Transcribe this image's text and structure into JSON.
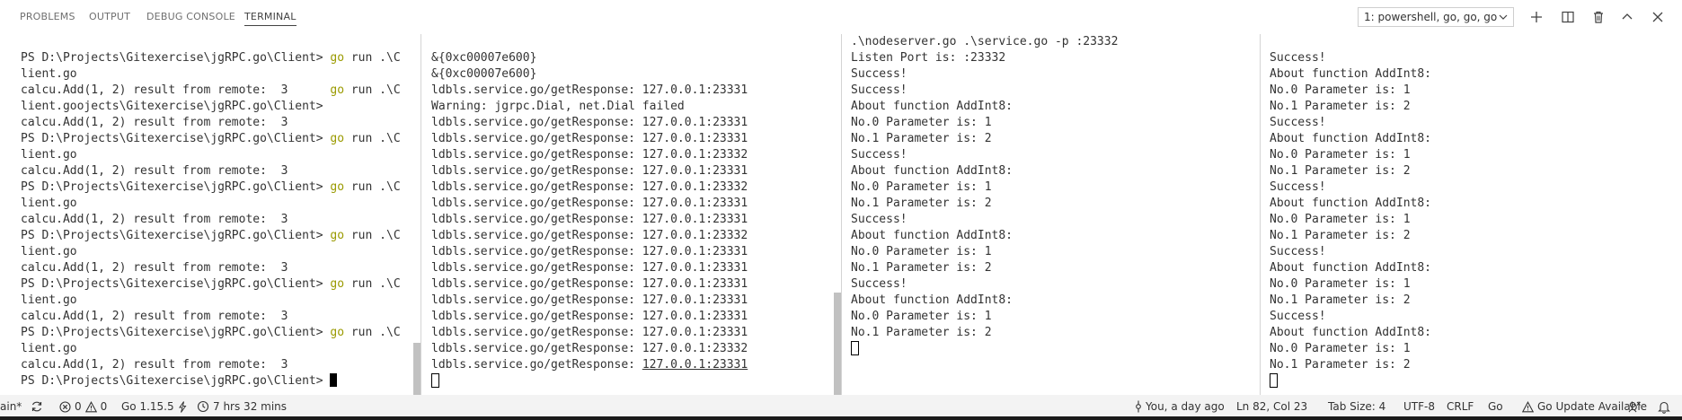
{
  "panel": {
    "tabs": [
      "PROBLEMS",
      "OUTPUT",
      "DEBUG CONSOLE",
      "TERMINAL"
    ],
    "active_tab": "TERMINAL",
    "terminal_select": "1: powershell, go, go, go"
  },
  "terminals": [
    {
      "lines": [
        {
          "text": ""
        },
        {
          "text": "PS D:\\Projects\\Gitexercise\\jgRPC.go\\Client> ",
          "cmd": "go",
          "rest": " run .\\C"
        },
        {
          "text": "lient.go"
        },
        {
          "text": "calcu.Add(1, 2) result from remote:  3      ",
          "cmd": "go",
          "rest": " run .\\C"
        },
        {
          "text": "lient.goojects\\Gitexercise\\jgRPC.go\\Client>"
        },
        {
          "text": "calcu.Add(1, 2) result from remote:  3"
        },
        {
          "text": "PS D:\\Projects\\Gitexercise\\jgRPC.go\\Client> ",
          "cmd": "go",
          "rest": " run .\\C"
        },
        {
          "text": "lient.go"
        },
        {
          "text": "calcu.Add(1, 2) result from remote:  3"
        },
        {
          "text": "PS D:\\Projects\\Gitexercise\\jgRPC.go\\Client> ",
          "cmd": "go",
          "rest": " run .\\C"
        },
        {
          "text": "lient.go"
        },
        {
          "text": "calcu.Add(1, 2) result from remote:  3"
        },
        {
          "text": "PS D:\\Projects\\Gitexercise\\jgRPC.go\\Client> ",
          "cmd": "go",
          "rest": " run .\\C"
        },
        {
          "text": "lient.go"
        },
        {
          "text": "calcu.Add(1, 2) result from remote:  3"
        },
        {
          "text": "PS D:\\Projects\\Gitexercise\\jgRPC.go\\Client> ",
          "cmd": "go",
          "rest": " run .\\C"
        },
        {
          "text": "lient.go"
        },
        {
          "text": "calcu.Add(1, 2) result from remote:  3"
        },
        {
          "text": "PS D:\\Projects\\Gitexercise\\jgRPC.go\\Client> ",
          "cmd": "go",
          "rest": " run .\\C"
        },
        {
          "text": "lient.go"
        },
        {
          "text": "calcu.Add(1, 2) result from remote:  3"
        },
        {
          "text": "PS D:\\Projects\\Gitexercise\\jgRPC.go\\Client> ",
          "cursor": "filled"
        }
      ]
    },
    {
      "lines": [
        {
          "text": ""
        },
        {
          "text": "&{0xc00007e600}"
        },
        {
          "text": "&{0xc00007e600}"
        },
        {
          "text": "ldbls.service.go/getResponse: 127.0.0.1:23331"
        },
        {
          "text": "Warning: jgrpc.Dial, net.Dial failed"
        },
        {
          "text": "ldbls.service.go/getResponse: 127.0.0.1:23331"
        },
        {
          "text": "ldbls.service.go/getResponse: 127.0.0.1:23331"
        },
        {
          "text": "ldbls.service.go/getResponse: 127.0.0.1:23332"
        },
        {
          "text": "ldbls.service.go/getResponse: 127.0.0.1:23331"
        },
        {
          "text": "ldbls.service.go/getResponse: 127.0.0.1:23332"
        },
        {
          "text": "ldbls.service.go/getResponse: 127.0.0.1:23331"
        },
        {
          "text": "ldbls.service.go/getResponse: 127.0.0.1:23331"
        },
        {
          "text": "ldbls.service.go/getResponse: 127.0.0.1:23332"
        },
        {
          "text": "ldbls.service.go/getResponse: 127.0.0.1:23331"
        },
        {
          "text": "ldbls.service.go/getResponse: 127.0.0.1:23331"
        },
        {
          "text": "ldbls.service.go/getResponse: 127.0.0.1:23331"
        },
        {
          "text": "ldbls.service.go/getResponse: 127.0.0.1:23331"
        },
        {
          "text": "ldbls.service.go/getResponse: 127.0.0.1:23331"
        },
        {
          "text": "ldbls.service.go/getResponse: 127.0.0.1:23331"
        },
        {
          "text": "ldbls.service.go/getResponse: 127.0.0.1:23332"
        },
        {
          "text": "ldbls.service.go/getResponse: ",
          "link": "127.0.0.1:23331"
        },
        {
          "text": "",
          "cursor": "hollow"
        }
      ]
    },
    {
      "lines": [
        {
          "text": ".\\nodeserver.go .\\service.go -p :23332"
        },
        {
          "text": "Listen Port is: :23332"
        },
        {
          "text": "Success!"
        },
        {
          "text": "Success!"
        },
        {
          "text": "About function AddInt8:"
        },
        {
          "text": "No.0 Parameter is: 1"
        },
        {
          "text": "No.1 Parameter is: 2"
        },
        {
          "text": "Success!"
        },
        {
          "text": "About function AddInt8:"
        },
        {
          "text": "No.0 Parameter is: 1"
        },
        {
          "text": "No.1 Parameter is: 2"
        },
        {
          "text": "Success!"
        },
        {
          "text": "About function AddInt8:"
        },
        {
          "text": "No.0 Parameter is: 1"
        },
        {
          "text": "No.1 Parameter is: 2"
        },
        {
          "text": "Success!"
        },
        {
          "text": "About function AddInt8:"
        },
        {
          "text": "No.0 Parameter is: 1"
        },
        {
          "text": "No.1 Parameter is: 2"
        },
        {
          "text": "",
          "cursor": "hollow"
        }
      ]
    },
    {
      "lines": [
        {
          "text": ""
        },
        {
          "text": "Success!"
        },
        {
          "text": "About function AddInt8:"
        },
        {
          "text": "No.0 Parameter is: 1"
        },
        {
          "text": "No.1 Parameter is: 2"
        },
        {
          "text": "Success!"
        },
        {
          "text": "About function AddInt8:"
        },
        {
          "text": "No.0 Parameter is: 1"
        },
        {
          "text": "No.1 Parameter is: 2"
        },
        {
          "text": "Success!"
        },
        {
          "text": "About function AddInt8:"
        },
        {
          "text": "No.0 Parameter is: 1"
        },
        {
          "text": "No.1 Parameter is: 2"
        },
        {
          "text": "Success!"
        },
        {
          "text": "About function AddInt8:"
        },
        {
          "text": "No.0 Parameter is: 1"
        },
        {
          "text": "No.1 Parameter is: 2"
        },
        {
          "text": "Success!"
        },
        {
          "text": "About function AddInt8:"
        },
        {
          "text": "No.0 Parameter is: 1"
        },
        {
          "text": "No.1 Parameter is: 2"
        },
        {
          "text": "",
          "cursor": "hollow"
        }
      ]
    }
  ],
  "status_bar": {
    "branch_fragment": "ain*",
    "errors": "0",
    "warnings": "0",
    "go_version": "Go 1.15.5",
    "time_tracked": "7 hrs 32 mins",
    "git_blame": "You, a day ago",
    "cursor_position": "Ln 82, Col 23",
    "tab_size": "Tab Size: 4",
    "encoding": "UTF-8",
    "line_ending": "CRLF",
    "language": "Go",
    "update": "Go Update Available"
  },
  "colors": {
    "command_highlight": "#9a9a00",
    "status_bar_bg": "#f3f3f3",
    "pane_border": "#d4d4d4"
  }
}
